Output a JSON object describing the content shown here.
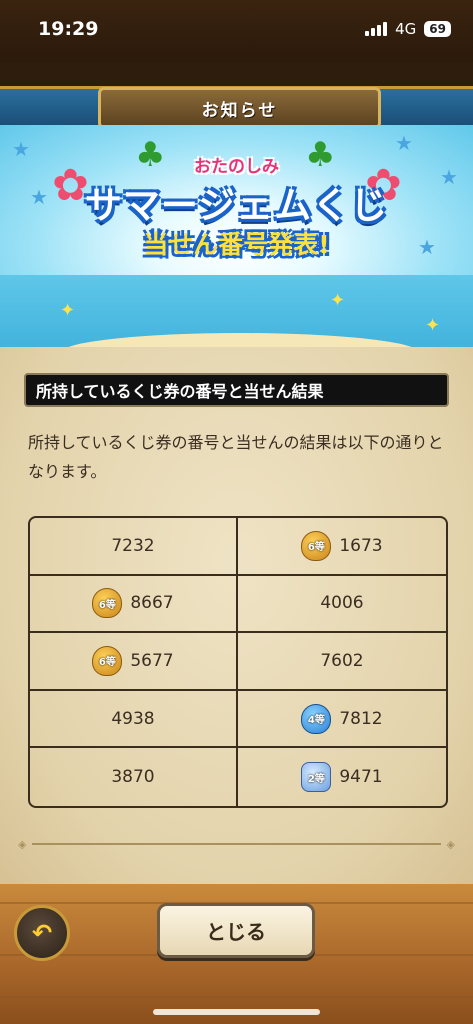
{
  "status_bar": {
    "time": "19:29",
    "network": "4G",
    "battery": "69"
  },
  "header": {
    "title": "お知らせ"
  },
  "banner": {
    "small_title": "おたのしみ",
    "main_title": "サマージェムくじ",
    "sub_title": "当せん番号発表!"
  },
  "section": {
    "label": "所持しているくじ券の番号と当せん結果",
    "description": "所持しているくじ券の番号と当せんの結果は以下の通りとなります。"
  },
  "tickets": [
    {
      "number": "7232",
      "prize": ""
    },
    {
      "number": "1673",
      "prize": "6等"
    },
    {
      "number": "8667",
      "prize": "6等"
    },
    {
      "number": "4006",
      "prize": ""
    },
    {
      "number": "5677",
      "prize": "6等"
    },
    {
      "number": "7602",
      "prize": ""
    },
    {
      "number": "4938",
      "prize": ""
    },
    {
      "number": "7812",
      "prize": "4等"
    },
    {
      "number": "3870",
      "prize": ""
    },
    {
      "number": "9471",
      "prize": "2等"
    }
  ],
  "footer": {
    "back_label": "↶",
    "close_label": "とじる"
  },
  "colors": {
    "accent_blue": "#1b4f78",
    "gold": "#c89a3a",
    "parchment": "#e3d3ab"
  }
}
